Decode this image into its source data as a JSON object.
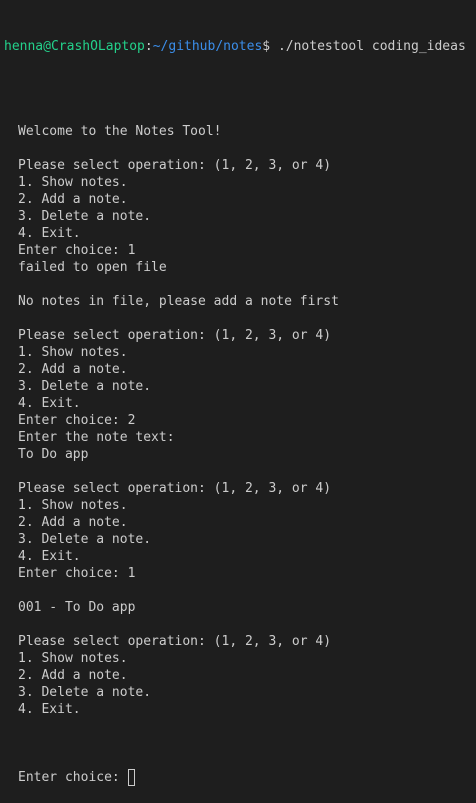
{
  "prompt": {
    "user_host": "henna@CrashOLaptop",
    "colon": ":",
    "path": "~/github/notes",
    "dollar": "$",
    "command": " ./notestool coding_ideas"
  },
  "lines": [
    "",
    "Welcome to the Notes Tool!",
    "",
    "Please select operation: (1, 2, 3, or 4)",
    "1. Show notes.",
    "2. Add a note.",
    "3. Delete a note.",
    "4. Exit.",
    "Enter choice: 1",
    "failed to open file",
    "",
    "No notes in file, please add a note first",
    "",
    "Please select operation: (1, 2, 3, or 4)",
    "1. Show notes.",
    "2. Add a note.",
    "3. Delete a note.",
    "4. Exit.",
    "Enter choice: 2",
    "Enter the note text:",
    "To Do app",
    "",
    "Please select operation: (1, 2, 3, or 4)",
    "1. Show notes.",
    "2. Add a note.",
    "3. Delete a note.",
    "4. Exit.",
    "Enter choice: 1",
    "",
    "001 - To Do app",
    "",
    "Please select operation: (1, 2, 3, or 4)",
    "1. Show notes.",
    "2. Add a note.",
    "3. Delete a note.",
    "4. Exit."
  ],
  "current_input": {
    "label": "Enter choice: "
  }
}
